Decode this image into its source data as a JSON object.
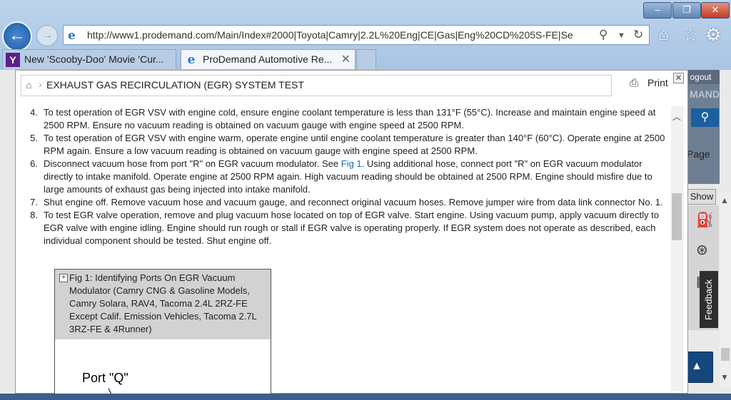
{
  "window": {
    "minimize": "‒",
    "maximize": "❐",
    "close": "✕"
  },
  "browser": {
    "url": "http://www1.prodemand.com/Main/Index#2000|Toyota|Camry|2.2L%20Eng|CE|Gas|Eng%20CD%205S-FE|Se",
    "tabs": [
      {
        "label": "New 'Scooby-Doo' Movie 'Cur...",
        "icon": "yahoo-icon",
        "active": false
      },
      {
        "label": "ProDemand Automotive Re...",
        "icon": "ie-icon",
        "active": true
      }
    ]
  },
  "background_page": {
    "logout": "ogout",
    "brand_fragment": "MAND",
    "page_label": "Page",
    "show_button": "Show",
    "feedback": "Feedback"
  },
  "modal": {
    "title": "EXHAUST GAS RECIRCULATION (EGR) SYSTEM TEST",
    "print_label": "Print",
    "steps": [
      {
        "num": "4.",
        "text": "To test operation of EGR VSV with engine cold, ensure engine coolant temperature is less than 131°F (55°C). Increase and maintain engine speed at 2500 RPM. Ensure no vacuum reading is obtained on vacuum gauge with engine speed at 2500 RPM."
      },
      {
        "num": "5.",
        "text": "To test operation of EGR VSV with engine warm, operate engine until engine coolant temperature is greater than 140°F (60°C). Operate engine at 2500 RPM again. Ensure a low vacuum reading is obtained on vacuum gauge with engine speed at 2500 RPM."
      },
      {
        "num": "6.",
        "text_before": "Disconnect vacuum hose from port \"R\" on EGR vacuum modulator. See ",
        "link": "Fig 1",
        "text_after": ". Using additional hose, connect port \"R\" on EGR vacuum modulator directly to intake manifold. Operate engine at 2500 RPM again. High vacuum reading should be obtained at 2500 RPM. Engine should misfire due to large amounts of exhaust gas being injected into intake manifold."
      },
      {
        "num": "7.",
        "text": "Shut engine off. Remove vacuum hose and vacuum gauge, and reconnect original vacuum hoses. Remove jumper wire from data link connector No. 1."
      },
      {
        "num": "8.",
        "text": "To test EGR valve operation, remove and plug vacuum hose located on top of EGR valve. Start engine. Using vacuum pump, apply vacuum directly to EGR valve with engine idling. Engine should run rough or stall if EGR valve is operating properly. If EGR system does not operate as described, each individual component should be tested. Shut engine off."
      }
    ],
    "figure": {
      "caption": "Fig 1: Identifying Ports On EGR Vacuum Modulator (Camry CNG & Gasoline Models, Camry Solara, RAV4, Tacoma 2.4L 2RZ-FE Except Calif. Emission Vehicles, Tacoma 2.7L 3RZ-FE & 4Runner)",
      "port_label": "Port \"Q\""
    }
  }
}
